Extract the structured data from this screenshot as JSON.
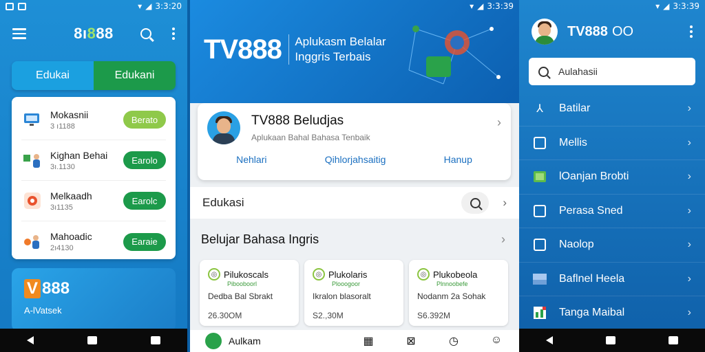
{
  "status": {
    "time_left": "3:3:20",
    "time_mid": "3:3:39",
    "time_right": "3:3:39"
  },
  "left": {
    "logo": "8ı8̶88",
    "logo_prefix": "8ı",
    "logo_accent": "8",
    "logo_suffix": "88",
    "tabs": [
      "Edukai",
      "Edukani"
    ],
    "items": [
      {
        "title": "Mokasnii",
        "sub": "3 ı1188",
        "button": "Berato"
      },
      {
        "title": "Kighan Behai",
        "sub": "3ı.1130",
        "button": "Earolo"
      },
      {
        "title": "Melkaadh",
        "sub": "3ı1135",
        "button": "Earolc"
      },
      {
        "title": "Mahoadic",
        "sub": "2ı4130",
        "button": "Earaie"
      }
    ],
    "promo_logo": "888",
    "promo_v": "V",
    "promo_sub": "A-lVatsek"
  },
  "middle": {
    "hero_brand": "TV888",
    "hero_line1": "Aplukasm Belalar",
    "hero_line2": "Inggris Terbais",
    "profile_name": "TV888 Beludjas",
    "profile_desc": "Aplukaan Bahal Bahasa Tenbaik",
    "profile_links": [
      "Nehlari",
      "Qihlorjahsaitig",
      "Hanup"
    ],
    "search_label": "Edukasi",
    "section_title": "Belujar Bahasa Ingris",
    "cards": [
      {
        "title": "Pilukoscals",
        "tag": "Pibooboorl",
        "desc": "Dedba Bal Sbrakt",
        "price": "26.30OM"
      },
      {
        "title": "Plukolaris",
        "tag": "Plooogoor",
        "desc": "Ikralon blasoralt",
        "price": "S2.,30M"
      },
      {
        "title": "Plukobeola",
        "tag": "Plnnoobefe",
        "desc": "Nodanm 2a Sohak",
        "price": "S6.392M"
      }
    ],
    "bottom_label": "Aulkam"
  },
  "right": {
    "title": "TV888",
    "title_suffix": "OO",
    "search_placeholder": "Aulahasii",
    "menu": [
      "Batilar",
      "Mellis",
      "lOanjan Brobti",
      "Perasa Sned",
      "Naolop",
      "Baflnel Heela",
      "Tanga Maibal"
    ]
  }
}
